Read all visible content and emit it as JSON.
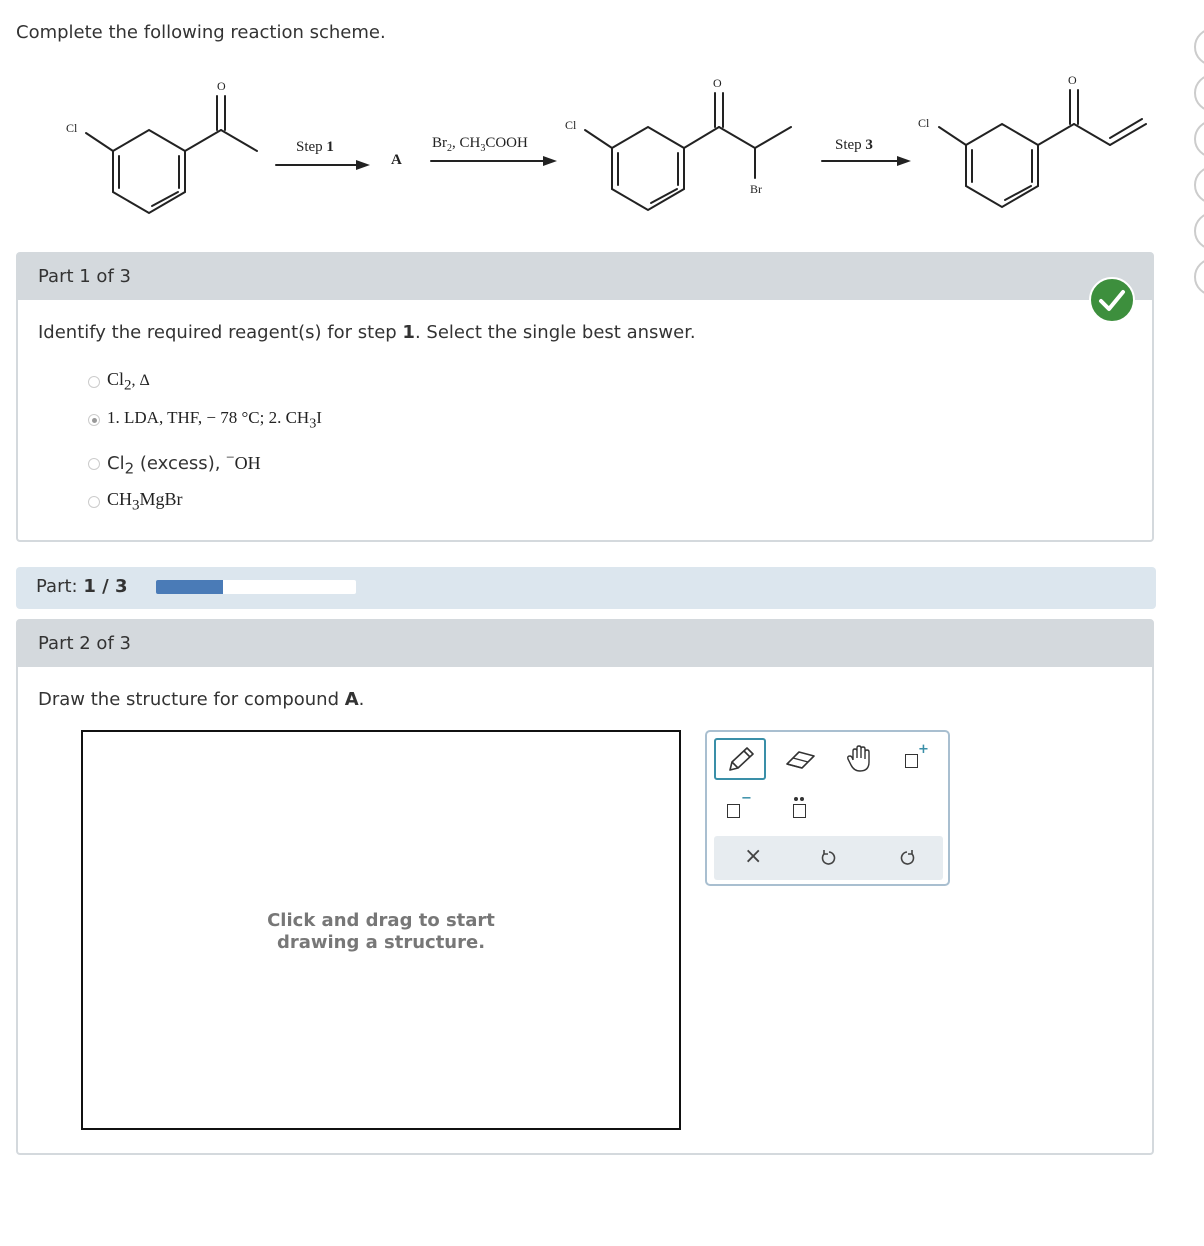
{
  "prompt": "Complete the following reaction scheme.",
  "scheme": {
    "step1_word": "Step ",
    "step1_num": "1",
    "compound_a": "A",
    "reagent_br": "Br",
    "reagent_br_sub": "2",
    "reagent_sep": ", ",
    "reagent_ch": "CH",
    "reagent_ch_sub": "3",
    "reagent_cooh": "COOH",
    "step3_word": "Step ",
    "step3_num": "3",
    "atom_cl": "Cl",
    "atom_o": "O",
    "atom_br": "Br"
  },
  "part1": {
    "header": "Part 1 of 3",
    "question_pre": "Identify the required reagent(s) for step ",
    "question_bold": "1",
    "question_post": ". Select the single best answer.",
    "options": [
      {
        "a": "Cl",
        "a_sub": "2",
        "b": ", Δ",
        "selected": false
      },
      {
        "a": "1. LDA, THF, − 78 °C; 2. CH",
        "a_sub": "3",
        "b": "I",
        "selected": true
      },
      {
        "a": "Cl",
        "a_sub": "2",
        "b": " (excess), ",
        "sup": "−",
        "c": "OH",
        "selected": false
      },
      {
        "a": "CH",
        "a_sub": "3",
        "b": "MgBr",
        "selected": false
      }
    ],
    "status": "correct",
    "status_icon": "check-circle-icon"
  },
  "progress": {
    "label": "Part: ",
    "current": "1 / 3",
    "fraction": 0.333
  },
  "part2": {
    "header": "Part 2 of 3",
    "question_pre": "Draw the structure for compound ",
    "question_bold": "A",
    "question_post": ".",
    "canvas_hint_line1": "Click and drag to start",
    "canvas_hint_line2": "drawing a structure."
  },
  "toolbox": {
    "tools": [
      "pencil-icon",
      "eraser-icon",
      "hand-pan-icon",
      "positive-charge-icon",
      "negative-charge-icon",
      "lone-pair-icon"
    ],
    "actions": [
      "clear-icon",
      "undo-icon",
      "redo-icon"
    ],
    "plus": "+",
    "minus": "−",
    "clear_glyph": "×"
  },
  "colors": {
    "accent": "#4a7bb7",
    "success": "#3d8f3d",
    "header_bg": "#d4d9dd",
    "progress_bg": "#dce6ee"
  }
}
